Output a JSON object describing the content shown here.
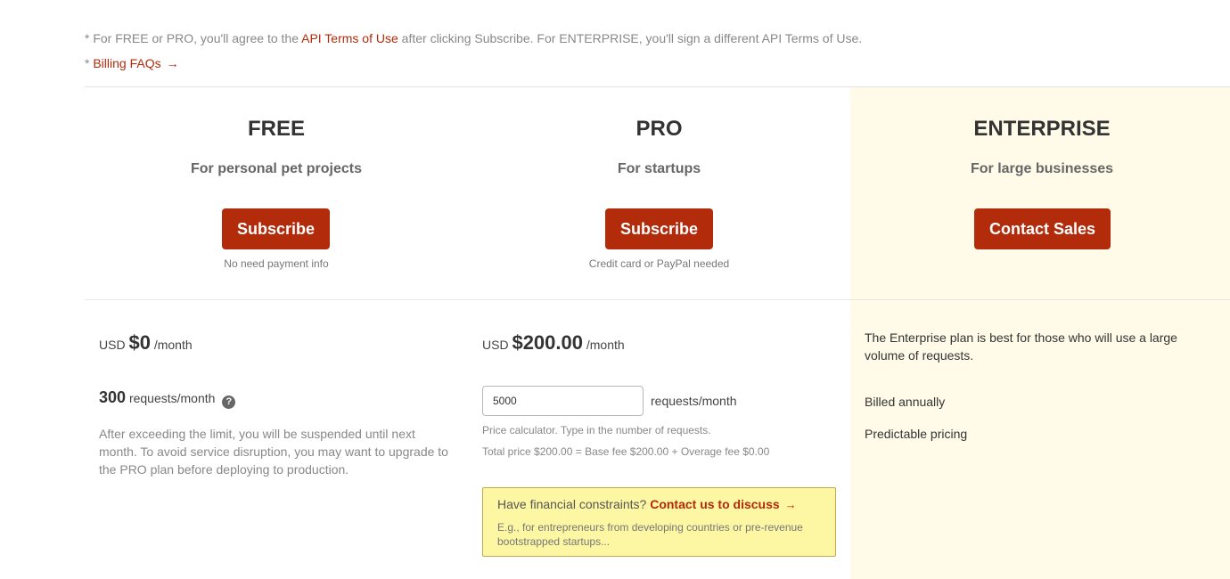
{
  "notes": {
    "line1_prefix": "* For FREE or PRO, you'll agree to the ",
    "line1_link": "API Terms of Use",
    "line1_suffix": " after clicking Subscribe. For ENTERPRISE, you'll sign a different API Terms of Use.",
    "line2_prefix": "* ",
    "line2_link": "Billing FAQs",
    "line2_arrow": "→"
  },
  "plans": {
    "free": {
      "name": "FREE",
      "tagline": "For personal pet projects",
      "button": "Subscribe",
      "subnote": "No need payment info",
      "currency": "USD",
      "price": "$0",
      "period": "/month",
      "requests": "300",
      "requests_unit": "requests/month",
      "help_icon": "?",
      "description": "After exceeding the limit, you will be suspended until next month. To avoid service disruption, you may want to upgrade to the PRO plan before deploying to production."
    },
    "pro": {
      "name": "PRO",
      "tagline": "For startups",
      "button": "Subscribe",
      "subnote": "Credit card or PayPal needed",
      "currency": "USD",
      "price": "$200.00",
      "period": "/month",
      "calculator_value": "5000",
      "requests_unit": "requests/month",
      "calculator_help": "Price calculator. Type in the number of requests.",
      "total_line": "Total price $200.00 = Base fee $200.00 + Overage fee $0.00",
      "financial": {
        "question": "Have financial constraints? ",
        "link": "Contact us to discuss",
        "arrow": "→",
        "description": "E.g., for entrepreneurs from developing countries or pre-revenue bootstrapped startups..."
      }
    },
    "enterprise": {
      "name": "ENTERPRISE",
      "tagline": "For large businesses",
      "button": "Contact Sales",
      "description": "The Enterprise plan is best for those who will use a large volume of requests.",
      "features": [
        "Billed annually",
        "Predictable pricing"
      ]
    }
  },
  "colors": {
    "accent": "#b22b0b",
    "enterprise_bg": "#fffbe8",
    "notice_bg": "#fdf6a3"
  },
  "icons": {
    "help": "question-circle-icon",
    "arrow": "arrow-right-icon"
  }
}
